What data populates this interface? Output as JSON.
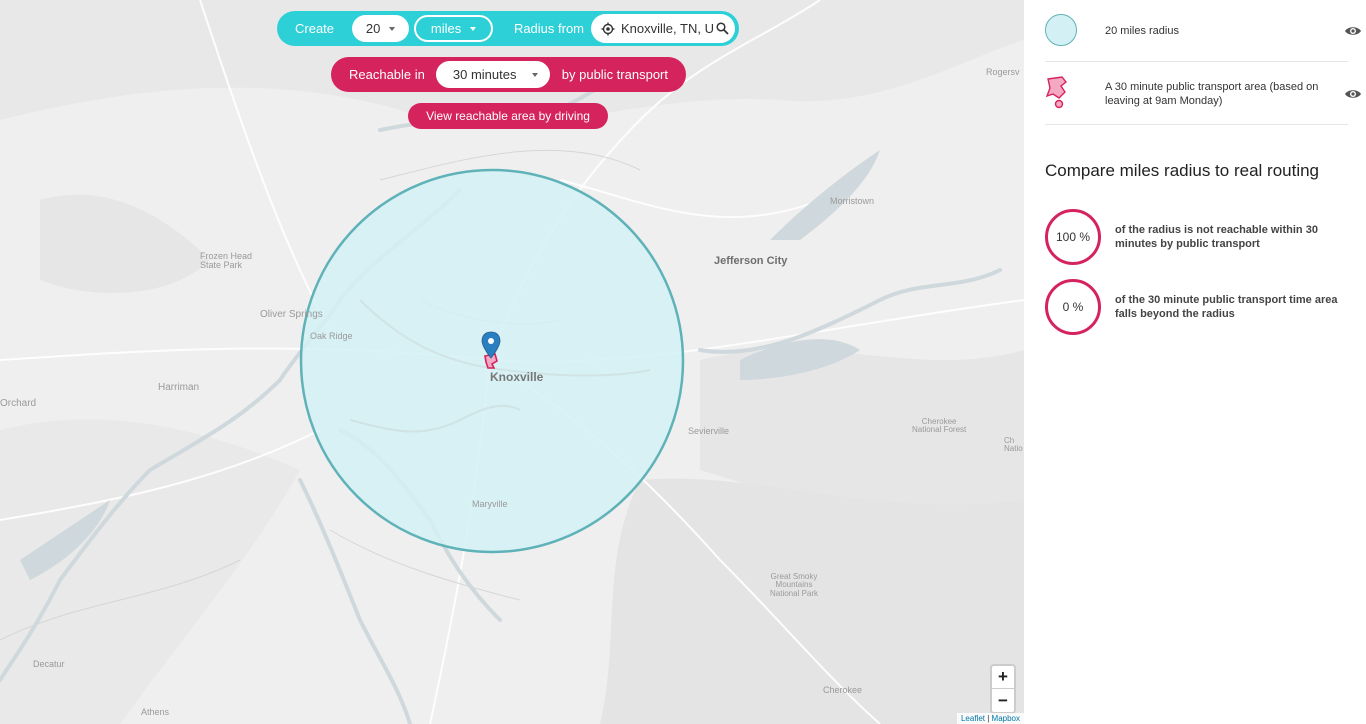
{
  "controls": {
    "create_label": "Create",
    "radius_value": "20",
    "unit": "miles",
    "radius_from_label": "Radius from",
    "location_value": "Knoxville, TN, U",
    "reachable_label": "Reachable in",
    "time_value": "30 minutes",
    "mode_label": "by public transport",
    "drive_button": "View reachable area by driving"
  },
  "map": {
    "places": {
      "knoxville": "Knoxville",
      "jefferson_city": "Jefferson City",
      "rogersville": "Rogersv",
      "morristown": "Morristown",
      "frozen_head": "Frozen Head\nState Park",
      "oliver_springs": "Oliver Springs",
      "oak_ridge": "Oak Ridge",
      "harriman": "Harriman",
      "orchard": "Orchard",
      "sevierville": "Sevierville",
      "cherokee_nf": "Cherokee\nNational Forest",
      "nation_cut": "Ch\nNatio",
      "maryville": "Maryville",
      "smoky": "Great Smoky\nMountains\nNational Park",
      "decatur": "Decatur",
      "athens": "Athens",
      "cherokee": "Cherokee"
    },
    "zoom_in": "+",
    "zoom_out": "−",
    "attribution_leaflet": "Leaflet",
    "attribution_sep": " | ",
    "attribution_mapbox": "Mapbox",
    "colors": {
      "radius_fill": "#d3f1f4",
      "radius_stroke": "#5fb2b8",
      "accent_pink": "#d5235d",
      "accent_teal": "#2ed0d8",
      "water": "#cfd8dc"
    }
  },
  "sidebar": {
    "legend": [
      {
        "icon": "radius-circle-icon",
        "label": "20 miles radius"
      },
      {
        "icon": "transport-area-icon",
        "label": "A 30 minute public transport area (based on leaving at 9am Monday)"
      }
    ],
    "compare_title": "Compare miles radius to real routing",
    "stats": [
      {
        "value": "100 %",
        "description": "of the radius is not reachable within 30 minutes by public transport"
      },
      {
        "value": "0 %",
        "description": "of the 30 minute public transport time area falls beyond the radius"
      }
    ]
  }
}
